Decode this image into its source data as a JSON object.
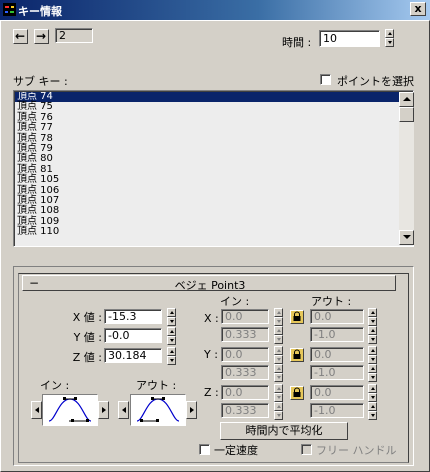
{
  "window": {
    "title": "キー情報",
    "close_glyph": "x"
  },
  "nav": {
    "prev_glyph": "←",
    "next_glyph": "→",
    "key_number": "2"
  },
  "time": {
    "label": "時間 :",
    "value": "10"
  },
  "subkey": {
    "label": "サブ キー :",
    "select_points_label": "ポイントを選択"
  },
  "list": {
    "items": [
      "頂点 74",
      "頂点 75",
      "頂点 76",
      "頂点 77",
      "頂点 78",
      "頂点 79",
      "頂点 80",
      "頂点 81",
      "頂点 105",
      "頂点 106",
      "頂点 107",
      "頂点 108",
      "頂点 109",
      "頂点 110"
    ],
    "selected_index": 0
  },
  "rollout": {
    "title": "ベジェ Point3",
    "collapse_glyph": "−",
    "values": [
      {
        "label": "X 値 :",
        "value": "-15.3"
      },
      {
        "label": "Y 値 :",
        "value": "-0.0"
      },
      {
        "label": "Z 値 :",
        "value": "30.184"
      }
    ],
    "in_header": "イン :",
    "out_header": "アウト :",
    "tangents": [
      {
        "axis": "X :",
        "in_top": "0.0",
        "in_bottom": "0.333",
        "out_top": "0.0",
        "out_bottom": "-1.0"
      },
      {
        "axis": "Y :",
        "in_top": "0.0",
        "in_bottom": "0.333",
        "out_top": "0.0",
        "out_bottom": "-1.0"
      },
      {
        "axis": "Z :",
        "in_top": "0.0",
        "in_bottom": "0.333",
        "out_top": "0.0",
        "out_bottom": "-1.0"
      }
    ],
    "in_curve_label": "イン :",
    "out_curve_label": "アウト :",
    "normalize_button": "時間内で平均化",
    "constant_velocity_label": "一定速度",
    "free_handle_label": "フリー ハンドル"
  },
  "colors": {
    "selection": "#0a246a",
    "lock": "#e6c75a",
    "curve": "#0000cc"
  }
}
